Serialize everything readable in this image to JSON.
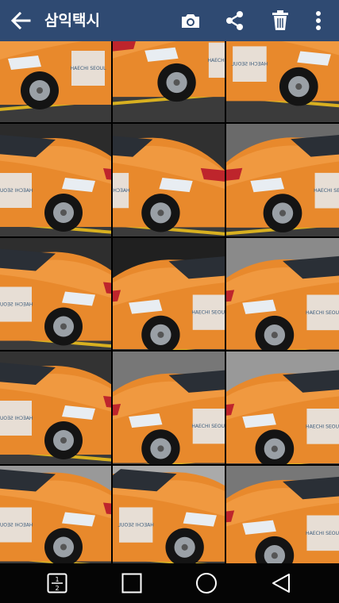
{
  "app_bar": {
    "title": "삼익택시",
    "icons": [
      "back-arrow-icon",
      "camera-icon",
      "share-icon",
      "trash-icon",
      "more-vert-icon"
    ]
  },
  "gallery": {
    "photo_count_visible": 15,
    "columns": 3
  },
  "decal_text": {
    "brand": "HAECHI SEOUL"
  },
  "nav_bar": {
    "dual_window_label": "1\n2",
    "icons": [
      "dual-window-icon",
      "recent-apps-icon",
      "home-icon",
      "back-icon"
    ]
  },
  "colors": {
    "app_bar": "#2f4a72",
    "taxi_orange": "#e8892c",
    "nav_bar": "#050505"
  }
}
